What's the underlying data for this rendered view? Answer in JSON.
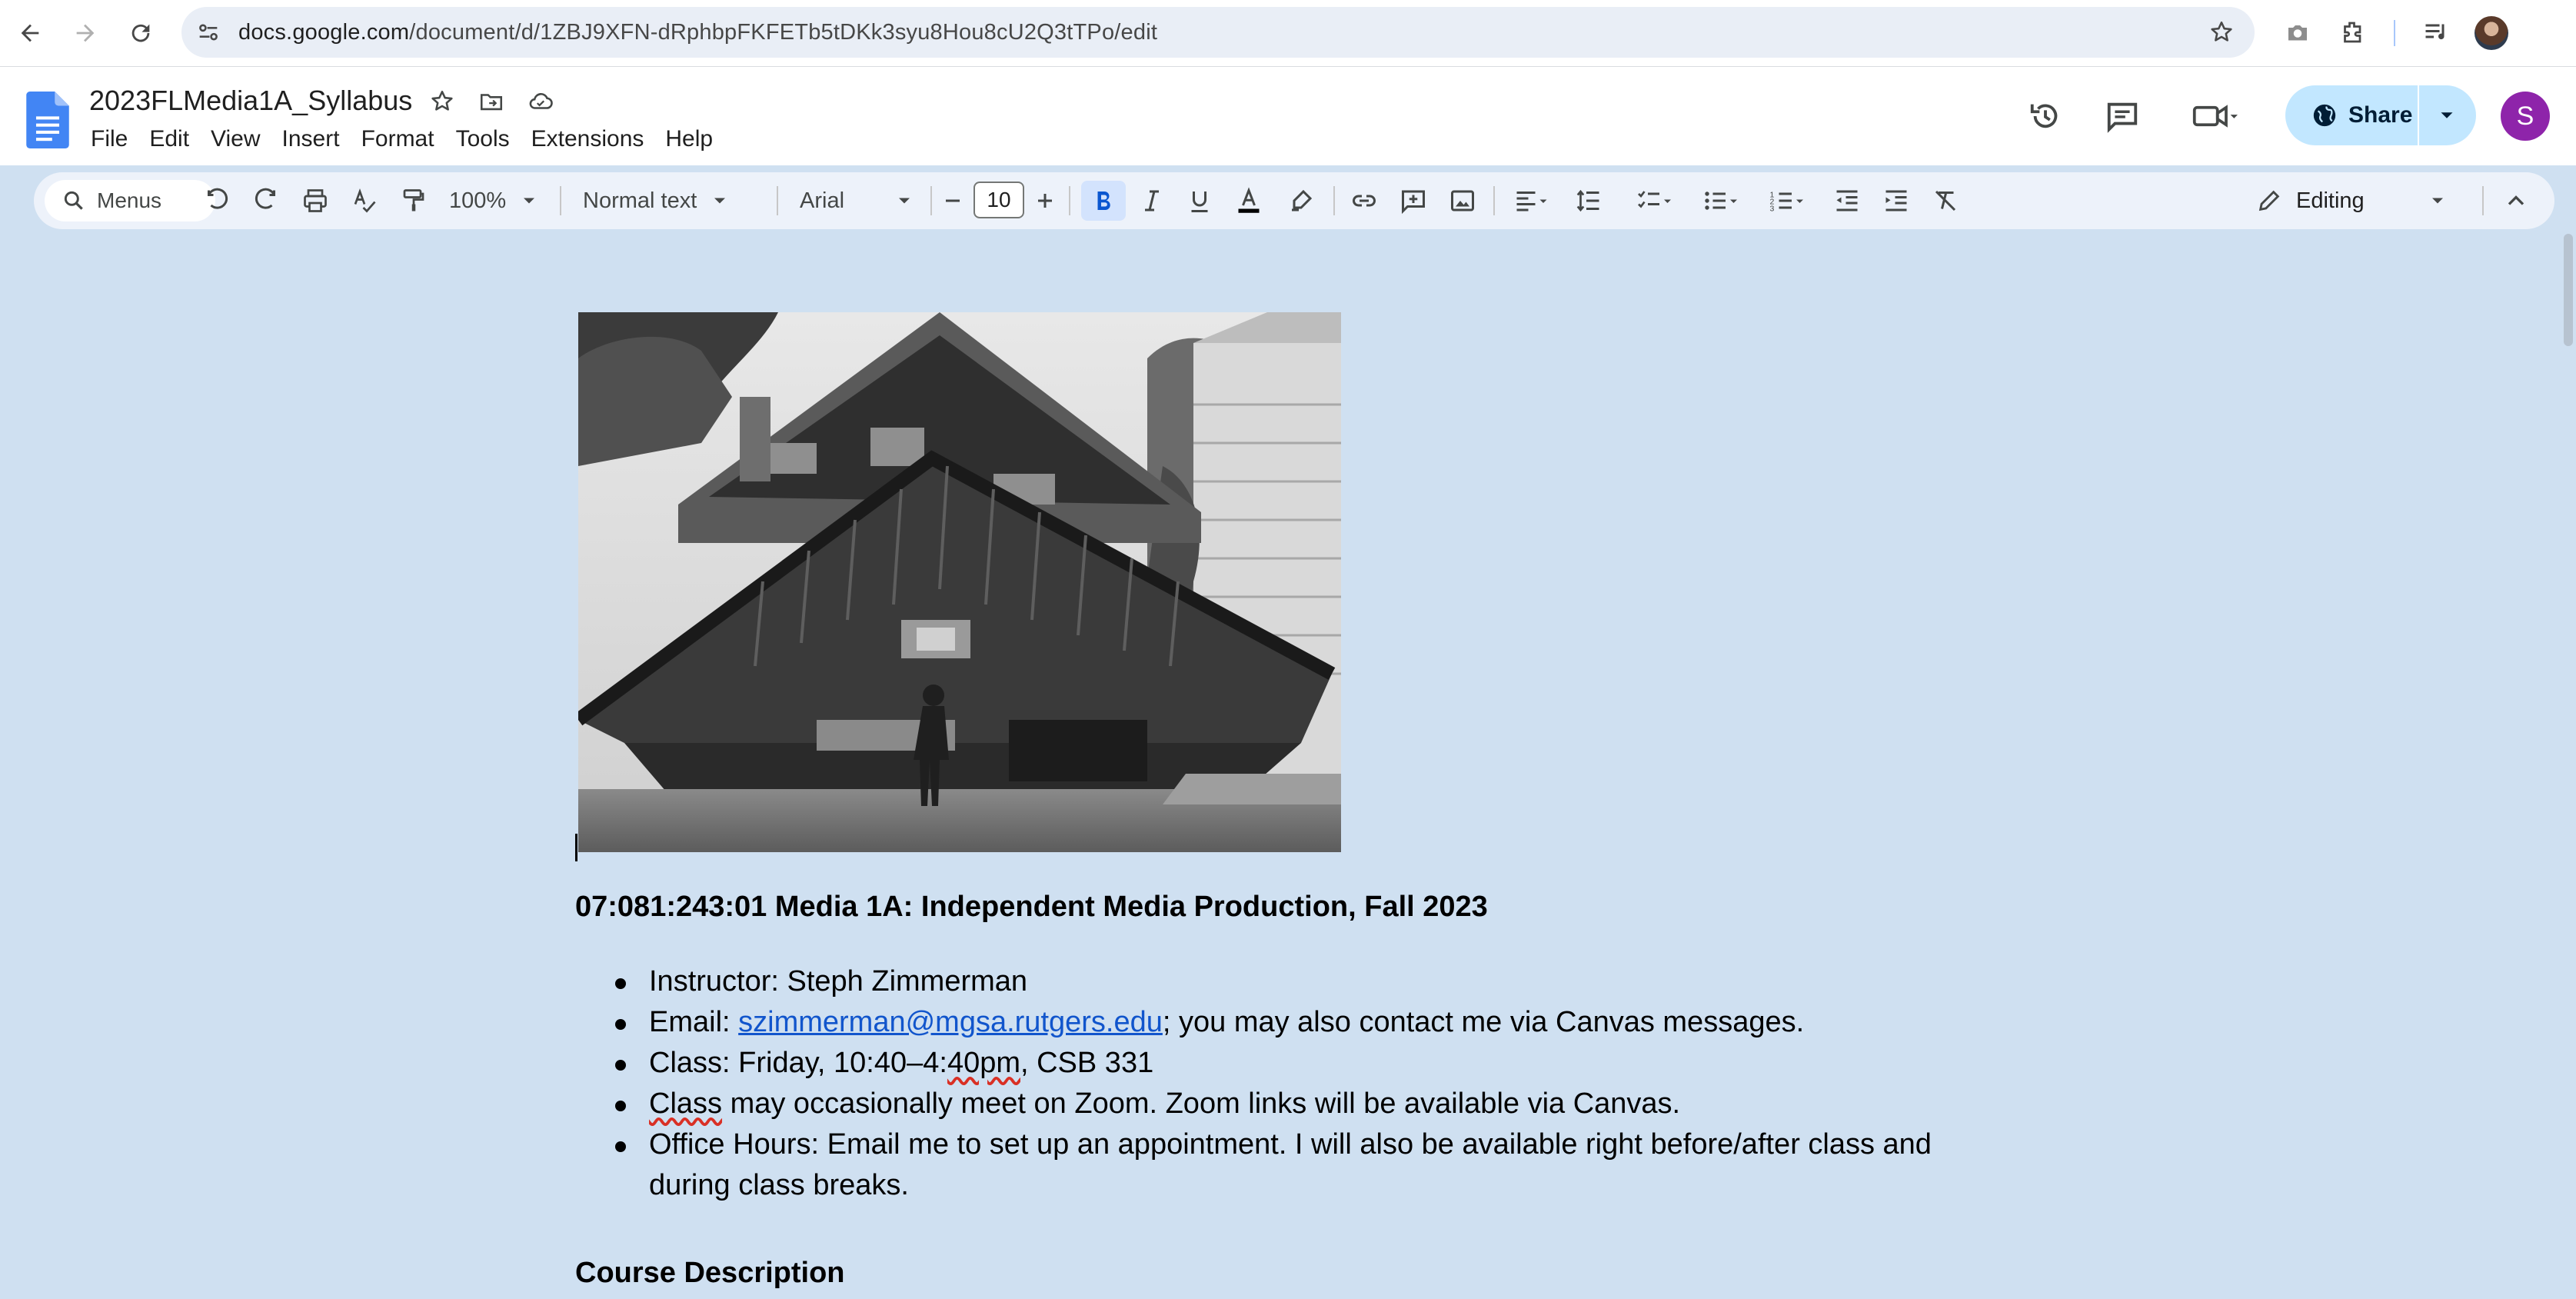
{
  "browser": {
    "url_main": "docs.google.com",
    "url_path": "/document/d/1ZBJ9XFN-dRphbpFKFETb5tDKk3syu8Hou8cU2Q3tTPo/edit"
  },
  "doc": {
    "title": "2023FLMedia1A_Syllabus",
    "menus": [
      "File",
      "Edit",
      "View",
      "Insert",
      "Format",
      "Tools",
      "Extensions",
      "Help"
    ],
    "share_label": "Share",
    "account_initial": "S"
  },
  "toolbar": {
    "menus_search": "Menus",
    "zoom": "100%",
    "style": "Normal text",
    "font": "Arial",
    "font_size": "10",
    "mode": "Editing"
  },
  "content": {
    "course_heading": "07:081:243:01 Media 1A: Independent Media Production, Fall 2023",
    "instructor": "Instructor: Steph Zimmerman",
    "email_prefix": "Email: ",
    "email_link": "szimmerman@mgsa.rutgers.edu",
    "email_suffix": "; you may also contact me via Canvas messages.",
    "class_prefix": "Class: Friday, 10:40–4:",
    "class_squiggle": "40pm",
    "class_suffix": ", CSB 331",
    "zoom_squiggle": "Class",
    "zoom_suffix": " may occasionally meet on Zoom. Zoom links will be available via Canvas.",
    "office_hours": "Office Hours: Email me to set up an appointment. I will also be available right before/after class and during class breaks.",
    "section_heading": "Course Description"
  },
  "colors": {
    "page_background": "#cfe0f1",
    "share_button": "#c2e7ff",
    "avatar": "#8e24aa",
    "link": "#1155cc"
  }
}
